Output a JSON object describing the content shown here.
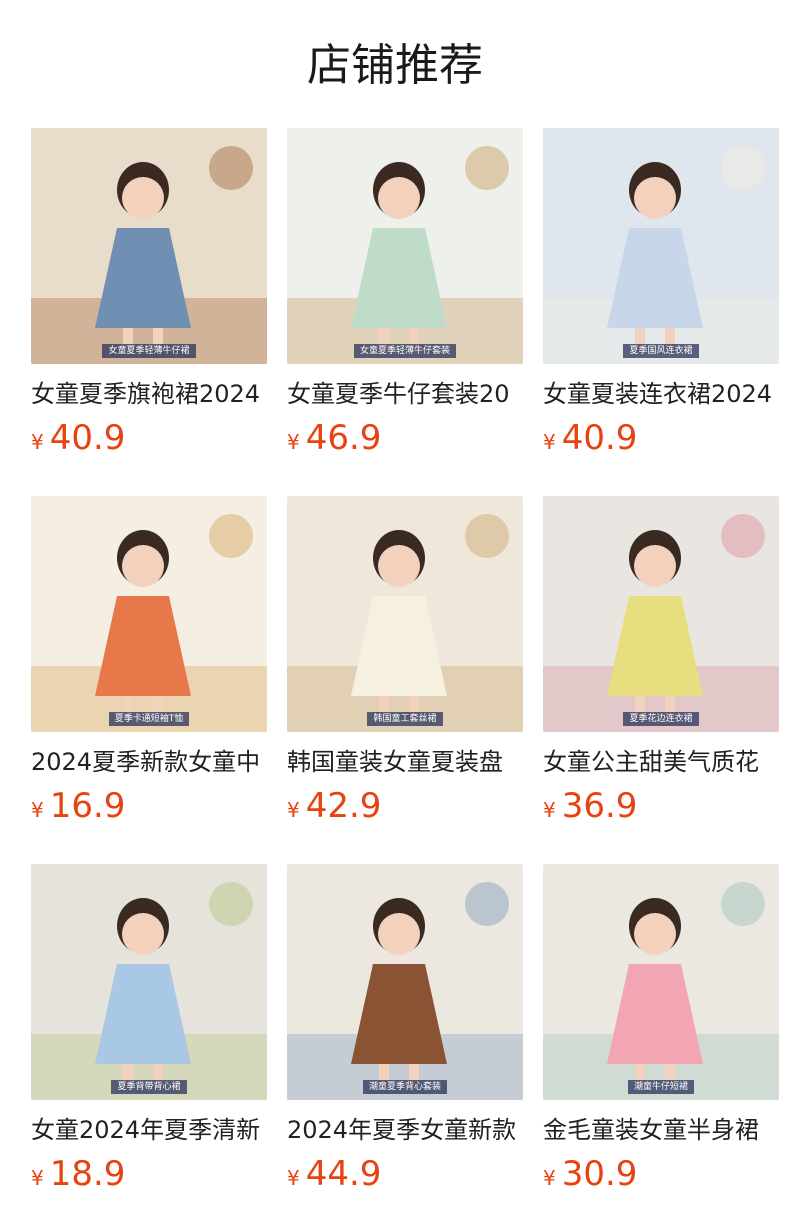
{
  "section": {
    "title": "店铺推荐"
  },
  "products": [
    {
      "title": "女童夏季旗袍裙2024",
      "currency": "¥",
      "price": "40.9",
      "image_tag": "女童夏季轻薄牛仔裙",
      "image_palette": [
        "#e8dccb",
        "#6f8fb3",
        "#a2683b"
      ]
    },
    {
      "title": "女童夏季牛仔套装20",
      "currency": "¥",
      "price": "46.9",
      "image_tag": "女童夏季轻薄牛仔套装",
      "image_palette": [
        "#eef0ec",
        "#bfdcc8",
        "#c89a5e"
      ]
    },
    {
      "title": "女童夏装连衣裙2024",
      "currency": "¥",
      "price": "40.9",
      "image_tag": "夏季国风连衣裙",
      "image_palette": [
        "#dfe6ee",
        "#c7d6e8",
        "#f3ede0"
      ]
    },
    {
      "title": "2024夏季新款女童中",
      "currency": "¥",
      "price": "16.9",
      "image_tag": "夏季卡通短袖T恤",
      "image_palette": [
        "#f4efe2",
        "#e8784a",
        "#d8a35a"
      ]
    },
    {
      "title": "韩国童装女童夏装盘",
      "currency": "¥",
      "price": "42.9",
      "image_tag": "韩国童工套丝裙",
      "image_palette": [
        "#efe8da",
        "#f6f0e1",
        "#c9a36d"
      ]
    },
    {
      "title": "女童公主甜美气质花",
      "currency": "¥",
      "price": "36.9",
      "image_tag": "夏季花边连衣裙",
      "image_palette": [
        "#e9e6e2",
        "#e7df7f",
        "#d98f9c"
      ]
    },
    {
      "title": "女童2024年夏季清新",
      "currency": "¥",
      "price": "18.9",
      "image_tag": "夏季背带背心裙",
      "image_palette": [
        "#e6e3dc",
        "#a9c8e6",
        "#b4c47a"
      ]
    },
    {
      "title": "2024年夏季女童新款",
      "currency": "¥",
      "price": "44.9",
      "image_tag": "潮童夏季背心套装",
      "image_palette": [
        "#ece7df",
        "#8a5434",
        "#7f9bbd"
      ]
    },
    {
      "title": "金毛童装女童半身裙",
      "currency": "¥",
      "price": "30.9",
      "image_tag": "潮童牛仔短裙",
      "image_palette": [
        "#ebe8e2",
        "#f2a6b4",
        "#9cc3b8"
      ]
    }
  ],
  "colors": {
    "price": "#e8420f",
    "title": "#222222",
    "heading": "#1a1a1a"
  }
}
